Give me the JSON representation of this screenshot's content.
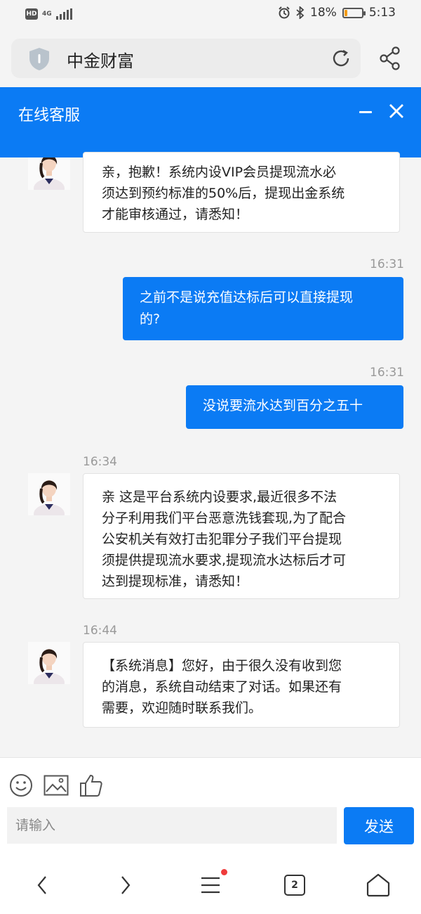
{
  "status_bar": {
    "network": "4G",
    "battery_percent": "18%",
    "time": "5:13",
    "battery_level": 0.18,
    "battery_color": "#f29b17"
  },
  "browser": {
    "page_title": "中金财富"
  },
  "chat": {
    "title": "在线客服",
    "accent_color": "#0b7bf4",
    "messages": [
      {
        "from": "agent",
        "time": "",
        "lines": [
          "亲，抱歉！系统内设VIP会员提现流水必",
          "须达到预约标准的50%后，提现出金系统",
          "才能审核通过，请悉知！"
        ]
      },
      {
        "from": "user",
        "time": "16:31",
        "lines": [
          "之前不是说充值达标后可以直接提现",
          "的?"
        ]
      },
      {
        "from": "user",
        "time": "16:31",
        "lines": [
          "没说要流水达到百分之五十"
        ]
      },
      {
        "from": "agent",
        "time": "16:34",
        "lines": [
          "亲 这是平台系统内设要求,最近很多不法",
          "分子利用我们平台恶意洗钱套现,为了配合",
          "公安机关有效打击犯罪分子我们平台提现",
          "须提供提现流水要求,提现流水达标后才可",
          "达到提现标准，请悉知！"
        ]
      },
      {
        "from": "agent",
        "time": "16:44",
        "lines": [
          "【系统消息】您好，由于很久没有收到您",
          "的消息，系统自动结束了对话。如果还有",
          "需要，欢迎随时联系我们。"
        ]
      }
    ]
  },
  "composer": {
    "placeholder": "请输入",
    "send_label": "发送"
  },
  "bottom_nav": {
    "tab_count": "2"
  }
}
